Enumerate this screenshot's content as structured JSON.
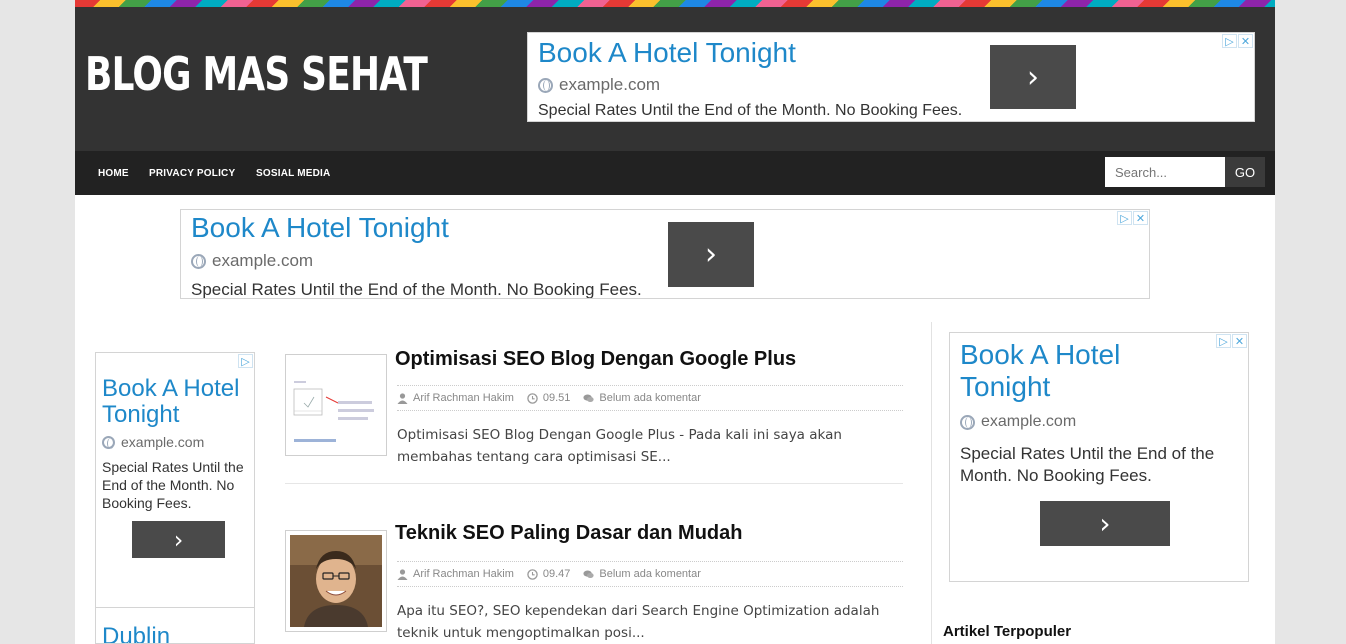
{
  "site": {
    "title": "BLOG MAS SEHAT"
  },
  "ad": {
    "title": "Book A Hotel Tonight",
    "title_line1": "Book A Hotel",
    "title_line2": "Tonight",
    "url": "example.com",
    "text": "Special Rates Until the End of the Month. No Booking Fees.",
    "text_right_l1": "Special Rates Until the End of the",
    "text_right_l2": "Month. No Booking Fees.",
    "text_left_l1": "Special Rates Until the",
    "text_left_l2": "End of the Month. No",
    "text_left_l3": "Booking Fees.",
    "next_title": "Dublin",
    "button_icon": "chevron-right-icon"
  },
  "nav": {
    "items": [
      {
        "label": "HOME"
      },
      {
        "label": "PRIVACY POLICY"
      },
      {
        "label": "SOSIAL MEDIA"
      }
    ],
    "search_placeholder": "Search...",
    "go_label": "GO"
  },
  "posts": [
    {
      "title": "Optimisasi SEO Blog Dengan Google Plus",
      "author": "Arif Rachman Hakim",
      "time": "09.51",
      "comments": "Belum ada komentar",
      "excerpt": "Optimisasi SEO Blog Dengan Google Plus - Pada kali ini saya akan membahas tentang cara optimisasi SE..."
    },
    {
      "title": "Teknik SEO Paling Dasar dan Mudah",
      "author": "Arif Rachman Hakim",
      "time": "09.47",
      "comments": "Belum ada komentar",
      "excerpt": "Apa itu SEO?, SEO kependekan dari Search Engine Optimization adalah teknik untuk mengoptimalkan posi..."
    }
  ],
  "sidebar": {
    "popular_title": "Artikel Terpopuler"
  },
  "colors": {
    "header": "#333333",
    "nav": "#222222",
    "ad_link": "#1e88c9",
    "ad_button": "#4a4a4a"
  }
}
